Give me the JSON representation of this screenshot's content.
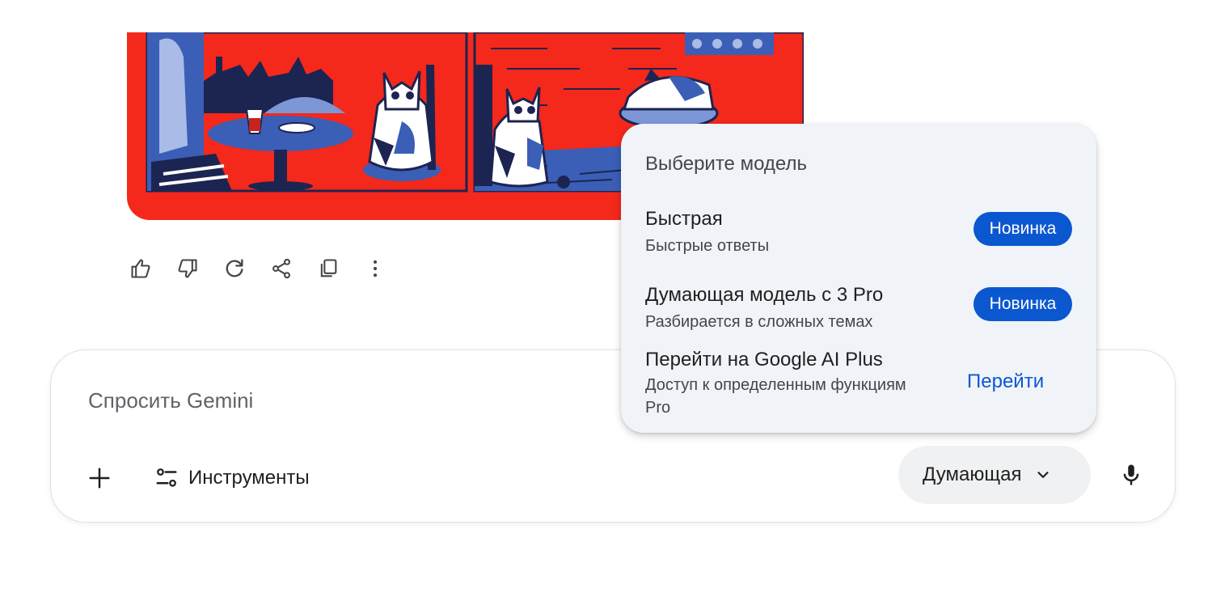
{
  "illustration": {
    "description_icon": "cats-cafe-illustration"
  },
  "actions": [
    {
      "name": "thumbs-up-icon"
    },
    {
      "name": "thumbs-down-icon"
    },
    {
      "name": "regenerate-icon"
    },
    {
      "name": "share-icon"
    },
    {
      "name": "copy-icon"
    },
    {
      "name": "more-vert-icon"
    }
  ],
  "prompt": {
    "placeholder": "Спросить Gemini",
    "tools_label": "Инструменты",
    "mode_label": "Думающая"
  },
  "menu": {
    "title": "Выберите модель",
    "items": [
      {
        "name": "Быстрая",
        "desc": "Быстрые ответы",
        "badge": "Новинка"
      },
      {
        "name": "Думающая модель с 3 Pro",
        "desc": "Разбирается в сложных темах",
        "badge": "Новинка"
      },
      {
        "name": "Перейти на Google AI Plus",
        "desc_line1": "Доступ к определенным функциям",
        "desc_line2": "Pro",
        "action": "Перейти"
      }
    ]
  },
  "colors": {
    "accent": "#0b57d0",
    "menu_bg": "#f0f4f9",
    "illustration_red": "#f4281b",
    "illustration_blue": "#3b5fb6"
  }
}
